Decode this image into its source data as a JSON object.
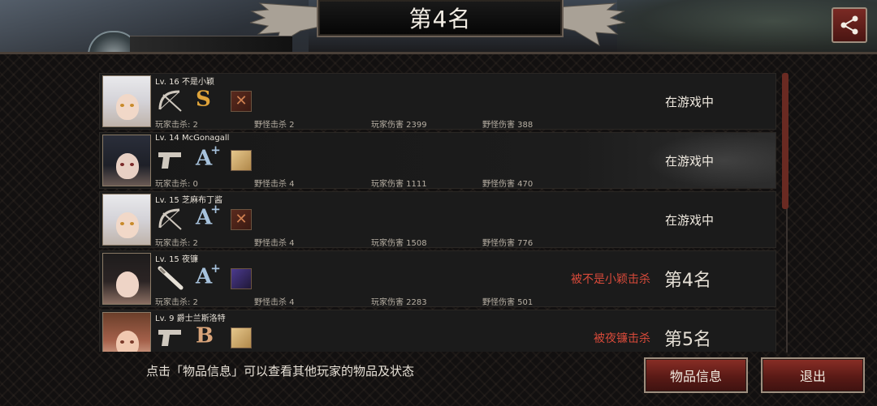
{
  "header": {
    "title": "第4名",
    "share_icon": "share-icon"
  },
  "players": [
    {
      "level_name": "Lv. 16 不是小颖",
      "weapon": "bow-icon",
      "rank": "S",
      "rank_plus": "",
      "item": "red",
      "stats": [
        "玩家击杀: 2",
        "野怪击杀 2",
        "玩家伤害 2399",
        "野怪伤害 388"
      ],
      "status": "在游戏中",
      "killed_by": "",
      "placement": ""
    },
    {
      "level_name": "Lv. 14 McGonagall",
      "weapon": "pistol-icon",
      "rank": "A",
      "rank_plus": "+",
      "item": "gold",
      "stats": [
        "玩家击杀: 0",
        "野怪击杀 4",
        "玩家伤害 1111",
        "野怪伤害 470"
      ],
      "status": "在游戏中",
      "killed_by": "",
      "placement": ""
    },
    {
      "level_name": "Lv. 15 芝麻布丁酱",
      "weapon": "bow-icon",
      "rank": "A",
      "rank_plus": "+",
      "item": "red",
      "stats": [
        "玩家击杀: 2",
        "野怪击杀 4",
        "玩家伤害 1508",
        "野怪伤害 776"
      ],
      "status": "在游戏中",
      "killed_by": "",
      "placement": ""
    },
    {
      "level_name": "Lv. 15 夜镰",
      "weapon": "bat-icon",
      "rank": "A",
      "rank_plus": "+",
      "item": "purple",
      "stats": [
        "玩家击杀: 2",
        "野怪击杀 4",
        "玩家伤害 2283",
        "野怪伤害 501"
      ],
      "status": "",
      "killed_by": "被不是小颖击杀",
      "placement": "第4名"
    },
    {
      "level_name": "Lv. 9  爵士兰斯洛特",
      "weapon": "pistol-icon",
      "rank": "B",
      "rank_plus": "",
      "item": "gold",
      "stats": [
        "",
        "",
        "",
        ""
      ],
      "status": "",
      "killed_by": "被夜镰击杀",
      "placement": "第5名"
    }
  ],
  "footer": {
    "hint": "点击「物品信息」可以查看其他玩家的物品及状态",
    "item_info_button": "物品信息",
    "exit_button": "退出"
  },
  "colors": {
    "accent": "#7a2a24",
    "killed_text": "#d84a3a",
    "rank_s": "#e0a43a",
    "rank_a": "#a7c2dc",
    "rank_b": "#d9a47a"
  }
}
